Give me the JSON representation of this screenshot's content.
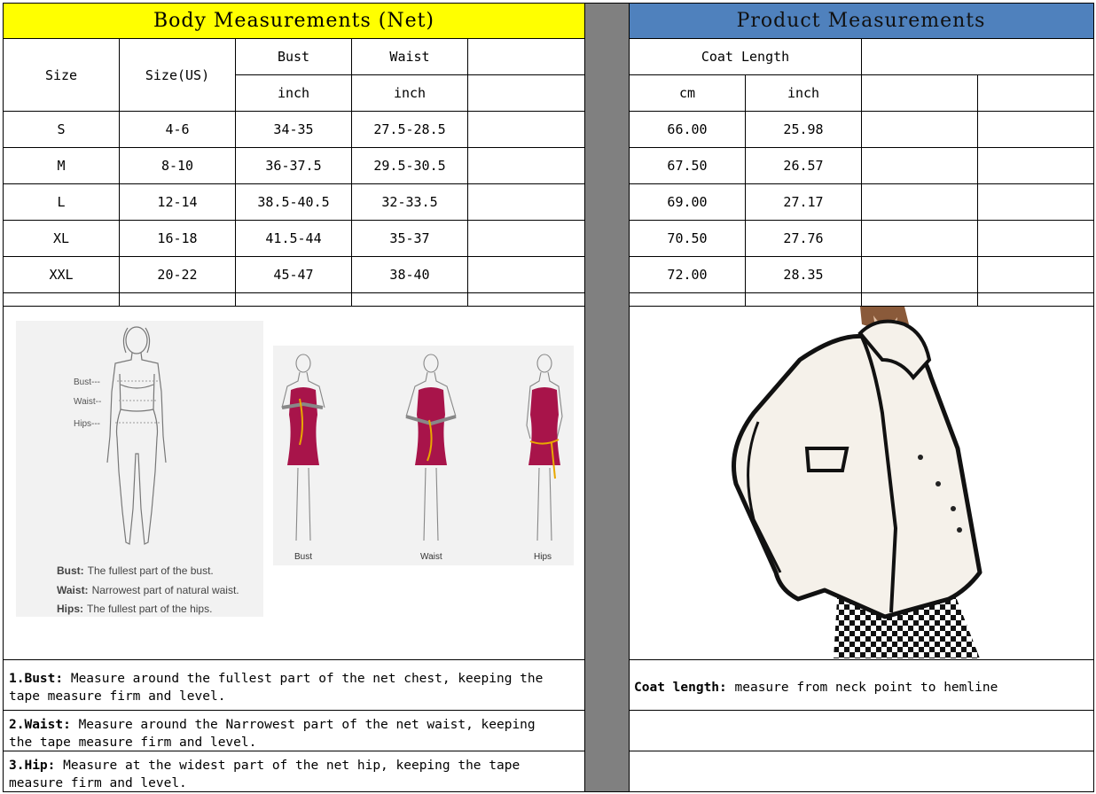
{
  "body_header": "Body Measurements (Net)",
  "product_header": "Product Measurements",
  "colors": {
    "yellow": "#FFFF00",
    "blue": "#4F81BD",
    "gray": "#808080",
    "garment": "#A8144A",
    "tape": "#E8A800"
  },
  "body_table": {
    "col_size": "Size",
    "col_size_us": "Size(US)",
    "col_bust": "Bust",
    "col_waist": "Waist",
    "unit_bust": "inch",
    "unit_waist": "inch",
    "rows": [
      {
        "size": "S",
        "us": "4-6",
        "bust": "34-35",
        "waist": "27.5-28.5"
      },
      {
        "size": "M",
        "us": "8-10",
        "bust": "36-37.5",
        "waist": "29.5-30.5"
      },
      {
        "size": "L",
        "us": "12-14",
        "bust": "38.5-40.5",
        "waist": "32-33.5"
      },
      {
        "size": "XL",
        "us": "16-18",
        "bust": "41.5-44",
        "waist": "35-37"
      },
      {
        "size": "XXL",
        "us": "20-22",
        "bust": "45-47",
        "waist": "38-40"
      }
    ]
  },
  "product_table": {
    "col_coat_length": "Coat Length",
    "unit_cm": "cm",
    "unit_inch": "inch",
    "rows": [
      {
        "cm": "66.00",
        "inch": "25.98"
      },
      {
        "cm": "67.50",
        "inch": "26.57"
      },
      {
        "cm": "69.00",
        "inch": "27.17"
      },
      {
        "cm": "70.50",
        "inch": "27.76"
      },
      {
        "cm": "72.00",
        "inch": "28.35"
      }
    ]
  },
  "diagram": {
    "label_bust": "Bust---",
    "label_waist": "Waist--",
    "label_hips": "Hips---",
    "def_bust_term": "Bust:",
    "def_bust_text": "The fullest part of the bust.",
    "def_waist_term": "Waist:",
    "def_waist_text": "Narrowest part of natural waist.",
    "def_hips_term": "Hips:",
    "def_hips_text": "The fullest part of the hips.",
    "fig_bust": "Bust",
    "fig_waist": "Waist",
    "fig_hips": "Hips"
  },
  "notes": {
    "bust_term": "1.Bust:",
    "bust_line1": "Measure around the fullest part of the net chest, keeping the",
    "bust_line2": "tape  measure firm and level.",
    "waist_term": "2.Waist:",
    "waist_line1": "Measure around the Narrowest part of the net waist, keeping",
    "waist_line2": "the tape  measure firm and level.",
    "hip_term": "3.Hip:",
    "hip_line1": "Measure at the widest part of the net hip, keeping the tape",
    "hip_line2": "measure firm and level.",
    "coat_term": "Coat length:",
    "coat_text": "measure from neck point to hemline"
  }
}
